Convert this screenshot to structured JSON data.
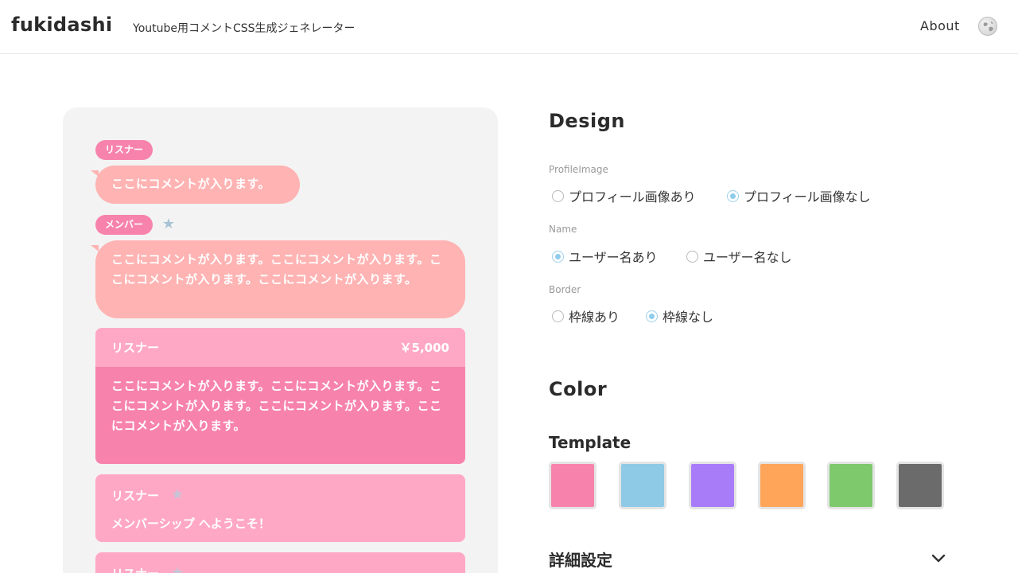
{
  "header": {
    "logo": "fukidashi",
    "tagline": "Youtube用コメントCSS生成ジェネレーター",
    "about_link": "About"
  },
  "preview": {
    "chat1": {
      "name": "リスナー",
      "text": "ここにコメントが入ります。"
    },
    "chat2": {
      "name": "メンバー",
      "text": "ここにコメントが入ります。ここにコメントが入ります。ここにコメントが入ります。ここにコメントが入ります。"
    },
    "superchat": {
      "name": "リスナー",
      "amount": "￥5,000",
      "text": "ここにコメントが入ります。ここにコメントが入ります。ここにコメントが入ります。ここにコメントが入ります。ここにコメントが入ります。"
    },
    "membership1": {
      "name": "リスナー",
      "text": "メンバーシップ へようこそ！"
    },
    "membership2": {
      "name": "リスナー"
    }
  },
  "settings": {
    "design_title": "Design",
    "profile_image": {
      "label": "ProfileImage",
      "options": [
        "プロフィール画像あり",
        "プロフィール画像なし"
      ],
      "selected": "プロフィール画像なし"
    },
    "name": {
      "label": "Name",
      "options": [
        "ユーザー名あり",
        "ユーザー名なし"
      ],
      "selected": "ユーザー名あり"
    },
    "border": {
      "label": "Border",
      "options": [
        "枠線あり",
        "枠線なし"
      ],
      "selected": "枠線なし"
    },
    "color_title": "Color",
    "template_label": "Template",
    "template_colors": [
      "#f783ac",
      "#8ecae6",
      "#a87cf8",
      "#ffa55a",
      "#7dc96c",
      "#6b6b6b"
    ],
    "details_label": "詳細設定"
  },
  "colors": {
    "accent_pink": "#f783ac",
    "bubble_pink": "#ffb3b3",
    "light_pink": "#ffa8c5",
    "radio_blue": "#90cdec"
  },
  "icons": [
    "globe-icon",
    "star-icon",
    "chevron-down-icon"
  ]
}
